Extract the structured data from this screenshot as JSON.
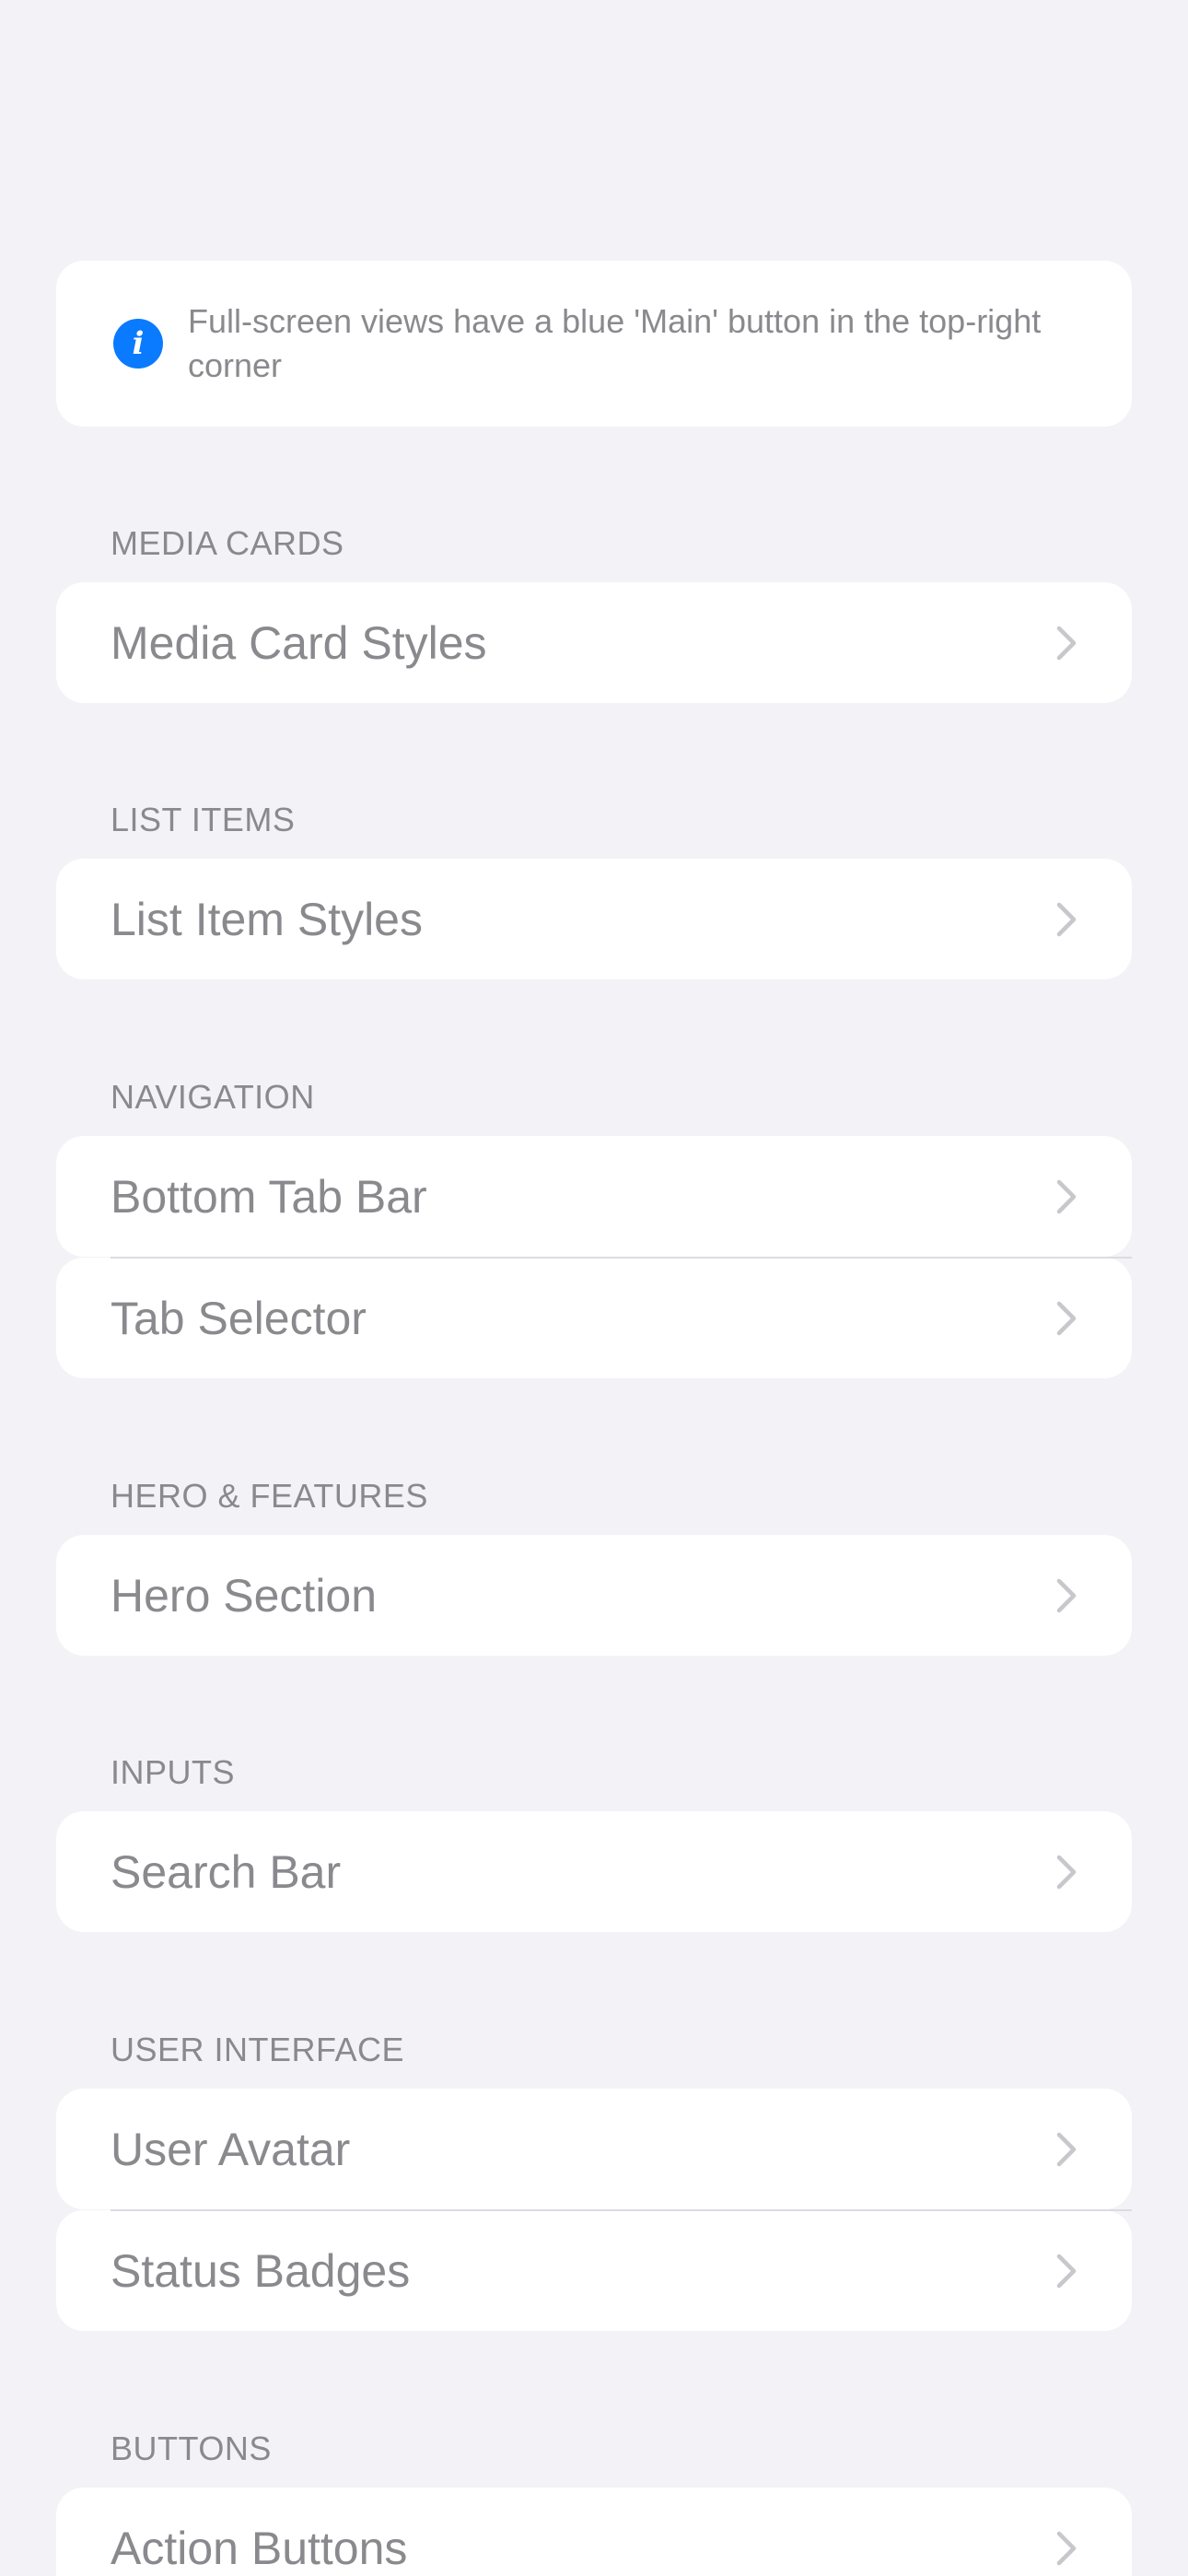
{
  "info_banner": {
    "icon": "info-icon",
    "text": "Full-screen views have a blue 'Main' button in the top-right corner"
  },
  "sections": {
    "media_cards": {
      "header": "MEDIA CARDS",
      "items": [
        {
          "label": "Media Card Styles"
        }
      ]
    },
    "list_items": {
      "header": "LIST ITEMS",
      "items": [
        {
          "label": "List Item Styles"
        }
      ]
    },
    "navigation": {
      "header": "NAVIGATION",
      "items": [
        {
          "label": "Bottom Tab Bar"
        },
        {
          "label": "Tab Selector"
        }
      ]
    },
    "hero_features": {
      "header": "HERO & FEATURES",
      "items": [
        {
          "label": "Hero Section"
        }
      ]
    },
    "inputs": {
      "header": "INPUTS",
      "items": [
        {
          "label": "Search Bar"
        }
      ]
    },
    "user_interface": {
      "header": "USER INTERFACE",
      "items": [
        {
          "label": "User Avatar"
        },
        {
          "label": "Status Badges"
        }
      ]
    },
    "buttons": {
      "header": "BUTTONS",
      "items": [
        {
          "label": "Action Buttons"
        }
      ]
    }
  },
  "colors": {
    "background": "#f2f2f7",
    "card": "#ffffff",
    "secondary_text": "#8a8a8e",
    "accent": "#0a7aff",
    "chevron": "#c7c7cc",
    "divider": "#dcdce0"
  },
  "icons": {
    "row_disclosure": "chevron-right-icon"
  }
}
